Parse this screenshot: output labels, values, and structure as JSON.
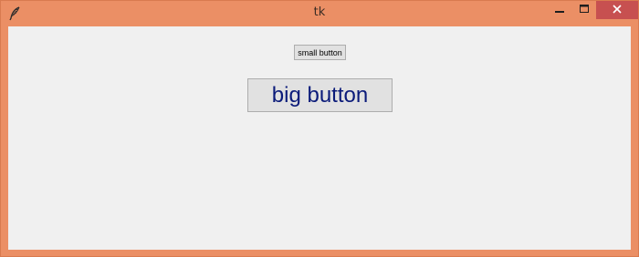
{
  "window": {
    "title": "tk",
    "frame_color": "#eb8f65",
    "client_background": "#f0f0f0",
    "icons": {
      "app": "feather-icon",
      "minimize": "minimize-icon",
      "maximize": "maximize-icon",
      "close": "close-icon"
    }
  },
  "buttons": {
    "small_label": "small button",
    "big_label": "big button",
    "big_text_color": "#0b1b7a"
  }
}
